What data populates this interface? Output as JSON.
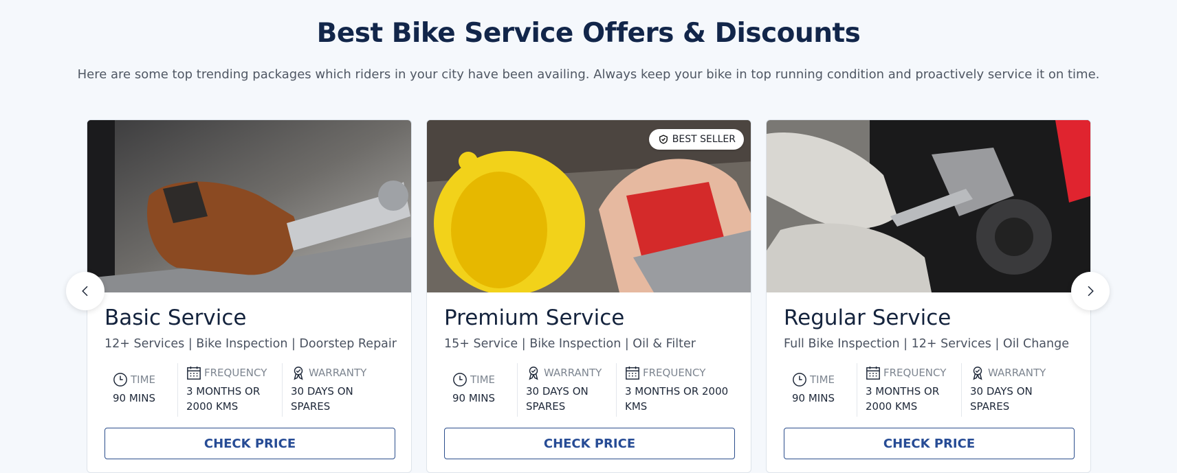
{
  "section": {
    "title": "Best Bike Service Offers & Discounts",
    "subtitle": "Here are some top trending packages which riders in your city have been availing. Always keep your bike in top running condition and proactively service it on time."
  },
  "cards": [
    {
      "title": "Basic Service",
      "description": "12+ Services | Bike Inspection | Doorstep Repair",
      "stats": [
        {
          "icon": "clock-icon",
          "label": "TIME",
          "value": "90 MINS"
        },
        {
          "icon": "calendar-icon",
          "label": "FREQUENCY",
          "value": "3 MONTHS OR 2000 KMS"
        },
        {
          "icon": "award-ribbon-icon",
          "label": "WARRANTY",
          "value": "30 DAYS ON SPARES"
        }
      ],
      "cta": "CHECK PRICE"
    },
    {
      "title": "Premium Service",
      "badge": "BEST SELLER",
      "description": "15+ Service | Bike Inspection | Oil & Filter",
      "stats": [
        {
          "icon": "clock-icon",
          "label": "TIME",
          "value": "90 MINS"
        },
        {
          "icon": "award-ribbon-icon",
          "label": "WARRANTY",
          "value": "30 DAYS ON SPARES"
        },
        {
          "icon": "calendar-icon",
          "label": "FREQUENCY",
          "value": "3 MONTHS OR 2000 KMS"
        }
      ],
      "cta": "CHECK PRICE"
    },
    {
      "title": "Regular Service",
      "description": "Full Bike Inspection | 12+ Services | Oil Change",
      "stats": [
        {
          "icon": "clock-icon",
          "label": "TIME",
          "value": "90 MINS"
        },
        {
          "icon": "calendar-icon",
          "label": "FREQUENCY",
          "value": "3 MONTHS OR 2000 KMS"
        },
        {
          "icon": "award-ribbon-icon",
          "label": "WARRANTY",
          "value": "30 DAYS ON SPARES"
        }
      ],
      "cta": "CHECK PRICE"
    }
  ],
  "carousel": {
    "prev_icon": "chevron-left-icon",
    "next_icon": "chevron-right-icon"
  },
  "colors": {
    "heading": "#12264a",
    "accent": "#274c95",
    "background": "#f5f8fc"
  }
}
